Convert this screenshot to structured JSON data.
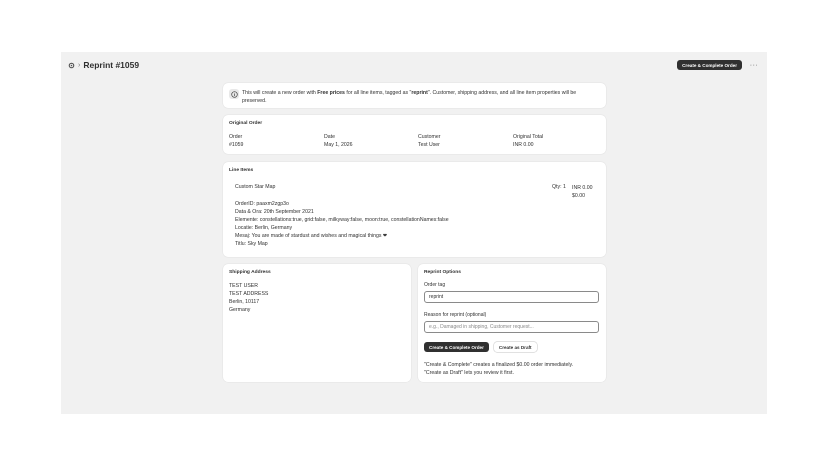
{
  "header": {
    "title": "Reprint #1059",
    "primary_action": "Create & Complete Order",
    "more_label": "···"
  },
  "banner": {
    "text_1": "This will create a new order with ",
    "text_bold_1": "Free prices",
    "text_2": " for all line items, tagged as \"",
    "text_bold_2": "reprint",
    "text_3": "\". Customer, shipping address, and all line item properties will be preserved."
  },
  "original_order": {
    "title": "Original Order",
    "columns": [
      {
        "label": "Order",
        "value": "#1059"
      },
      {
        "label": "Date",
        "value": "May 1, 2026"
      },
      {
        "label": "Customer",
        "value": "Test User"
      },
      {
        "label": "Original Total",
        "value": "INR 0.00"
      }
    ]
  },
  "line_items": {
    "title": "Line Items",
    "items": [
      {
        "name": "Custom Star Map",
        "qty": "Qty: 1",
        "price_original": "INR 0.00",
        "price_new": "$0.00",
        "properties": [
          "OrderID: paaxm2zgp3o",
          "Data & Ora: 20th September 2021",
          "Elemente: constellations:true, grid:false, milkyway:false, moon:true, constellationNames:false",
          "Locatie: Berlin, Germany",
          "Mesaj: You are made of stardust and wishes and magical things ❤",
          "Titlu: Sky Map"
        ]
      }
    ]
  },
  "shipping": {
    "title": "Shipping Address",
    "lines": [
      "TEST USER",
      "TEST ADDRESS",
      "Berlin, 10117",
      "Germany"
    ]
  },
  "reprint_options": {
    "title": "Reprint Options",
    "tag_label": "Order tag",
    "tag_value": "reprint",
    "reason_label": "Reason for reprint (optional)",
    "reason_placeholder": "e.g., Damaged in shipping, Customer request...",
    "complete_button": "Create & Complete Order",
    "draft_button": "Create as Draft",
    "note_1": "\"Create & Complete\" creates a finalized $0.00 order immediately.",
    "note_2": "\"Create as Draft\" lets you review it first."
  }
}
